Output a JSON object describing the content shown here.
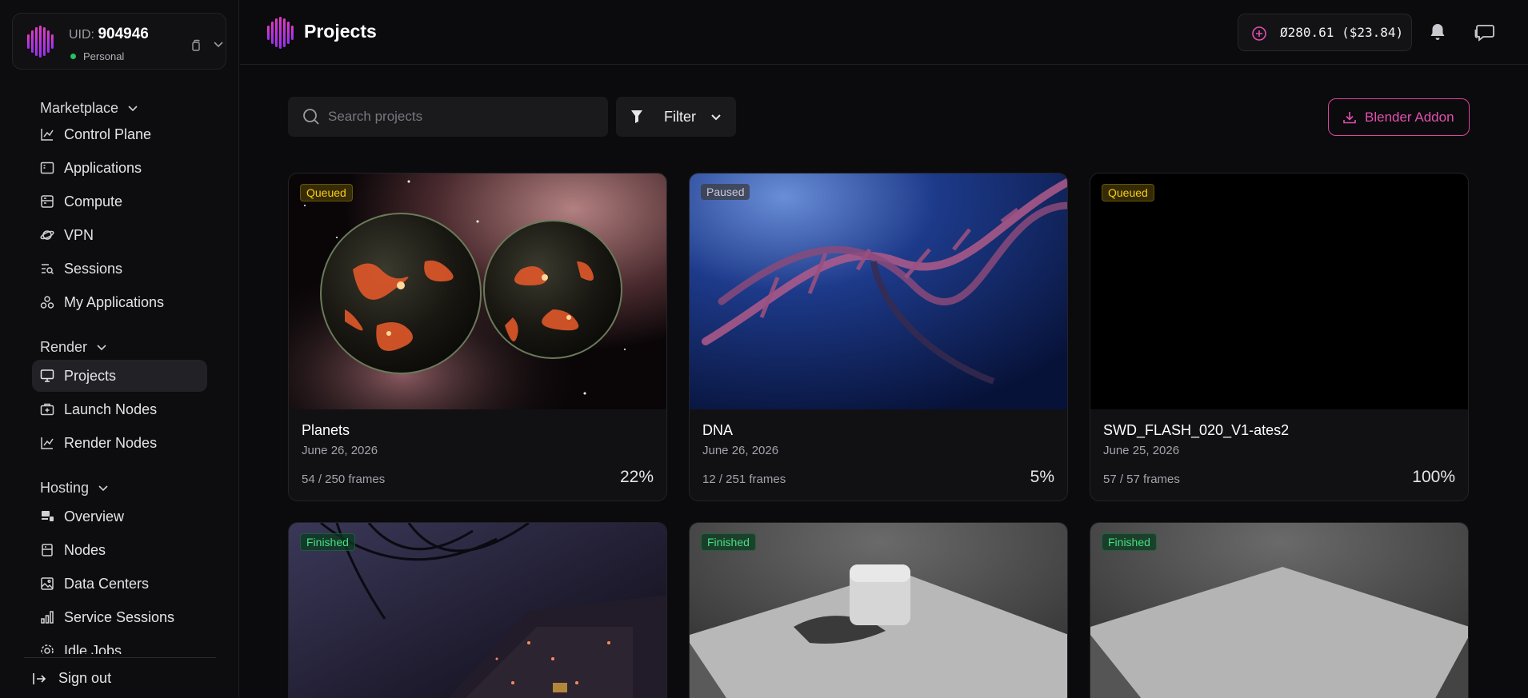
{
  "account": {
    "uid_label": "UID:",
    "uid": "904946",
    "persona": "Personal",
    "status_color": "#22c55e"
  },
  "nav": {
    "marketplace": {
      "label": "Marketplace",
      "items": [
        {
          "label": "Control Plane",
          "icon": "chart-line-icon"
        },
        {
          "label": "Applications",
          "icon": "app-window-icon"
        },
        {
          "label": "Compute",
          "icon": "server-icon"
        },
        {
          "label": "VPN",
          "icon": "planet-icon"
        },
        {
          "label": "Sessions",
          "icon": "list-search-icon"
        },
        {
          "label": "My Applications",
          "icon": "apps-icon"
        }
      ]
    },
    "render": {
      "label": "Render",
      "items": [
        {
          "label": "Projects",
          "icon": "monitor-icon",
          "active": true
        },
        {
          "label": "Launch Nodes",
          "icon": "briefcase-plus-icon"
        },
        {
          "label": "Render Nodes",
          "icon": "chart-line-icon"
        }
      ]
    },
    "hosting": {
      "label": "Hosting",
      "items": [
        {
          "label": "Overview",
          "icon": "dashboard-icon"
        },
        {
          "label": "Nodes",
          "icon": "database-icon"
        },
        {
          "label": "Data Centers",
          "icon": "image-icon"
        },
        {
          "label": "Service Sessions",
          "icon": "bar-chart-icon"
        },
        {
          "label": "Idle Jobs",
          "icon": "gear-icon"
        }
      ]
    },
    "signout": "Sign out"
  },
  "header": {
    "title": "Projects",
    "balance": "Ø280.61 ($23.84)",
    "accent": "#e150ad"
  },
  "toolbar": {
    "search_placeholder": "Search projects",
    "filter_label": "Filter",
    "addon_label": "Blender Addon"
  },
  "projects": [
    {
      "name": "Planets",
      "date": "June 26, 2026",
      "frames": "54 / 250 frames",
      "progress": "22%",
      "status": "Queued"
    },
    {
      "name": "DNA",
      "date": "June 26, 2026",
      "frames": "12 / 251 frames",
      "progress": "5%",
      "status": "Paused"
    },
    {
      "name": "SWD_FLASH_020_V1-ates2",
      "date": "June 25, 2026",
      "frames": "57 / 57 frames",
      "progress": "100%",
      "status": "Queued"
    },
    {
      "status": "Finished"
    },
    {
      "status": "Finished"
    },
    {
      "status": "Finished"
    }
  ]
}
